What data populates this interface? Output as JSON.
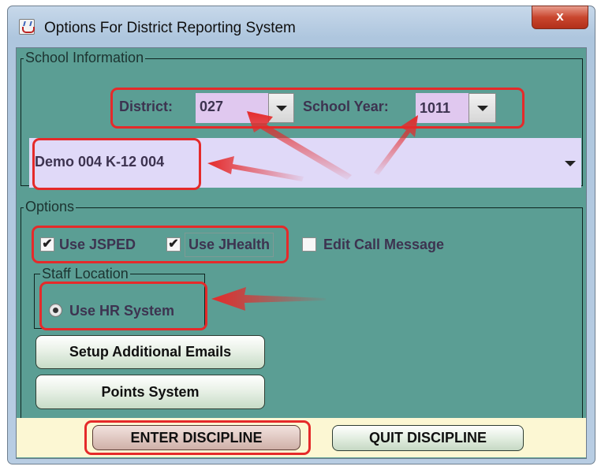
{
  "window": {
    "title": "Options For District Reporting System",
    "close_glyph": "x"
  },
  "school_info": {
    "legend": "School Information",
    "district_label": "District:",
    "district_value": "027",
    "school_year_label": "School Year:",
    "school_year_value": "1011",
    "school_value": "Demo 004 K-12 004"
  },
  "options": {
    "legend": "Options",
    "use_jsped": {
      "label": "Use JSPED",
      "checked": true
    },
    "use_jhealth": {
      "label": "Use JHealth",
      "checked": true
    },
    "edit_call_message": {
      "label": "Edit Call Message",
      "checked": false
    },
    "staff_location": {
      "legend": "Staff Location",
      "use_hr_system": {
        "label": "Use HR System",
        "selected": true
      }
    },
    "setup_emails_label": "Setup Additional Emails",
    "points_system_label": "Points System"
  },
  "footer": {
    "enter_label": "ENTER DISCIPLINE",
    "quit_label": "QUIT DISCIPLINE"
  },
  "colors": {
    "panel": "#5b9e94",
    "field": "#e0c8ef",
    "highlight": "#e52a2a",
    "footer": "#fcf7d3"
  },
  "icons": {
    "app": "java-cup-icon",
    "close": "close-icon",
    "check": "checkmark-icon",
    "dropdown": "chevron-down-icon"
  }
}
